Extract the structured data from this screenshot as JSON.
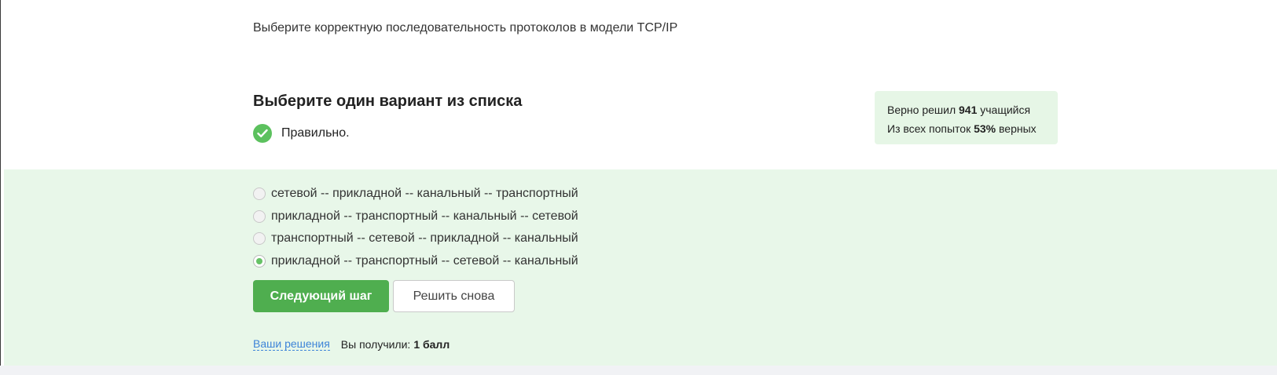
{
  "question": {
    "text": "Выберите корректную последовательность протоколов в модели TCP/IP"
  },
  "task": {
    "title": "Выберите один вариант из списка",
    "result_label": "Правильно."
  },
  "stats": {
    "solved_prefix": "Верно решил",
    "solved_count": "941",
    "solved_suffix": "учащийся",
    "attempts_prefix": "Из всех попыток",
    "attempts_percent": "53%",
    "attempts_suffix": "верных"
  },
  "options": [
    {
      "label": "сетевой -- прикладной -- канальный -- транспортный",
      "selected": false
    },
    {
      "label": "прикладной -- транспортный -- канальный -- сетевой",
      "selected": false
    },
    {
      "label": "транспортный -- сетевой -- прикладной -- канальный",
      "selected": false
    },
    {
      "label": "прикладной -- транспортный -- сетевой -- канальный",
      "selected": true
    }
  ],
  "buttons": {
    "next_label": "Следующий шаг",
    "retry_label": "Решить снова"
  },
  "footer": {
    "solutions_link": "Ваши решения",
    "score_prefix": "Вы получили:",
    "score_value": "1 балл"
  },
  "colors": {
    "accent_green": "#4fae4f",
    "check_green": "#5cc15e",
    "answer_bg": "#e8f7e9",
    "stats_bg": "#e6f6e6",
    "link_blue": "#3e84d8"
  }
}
